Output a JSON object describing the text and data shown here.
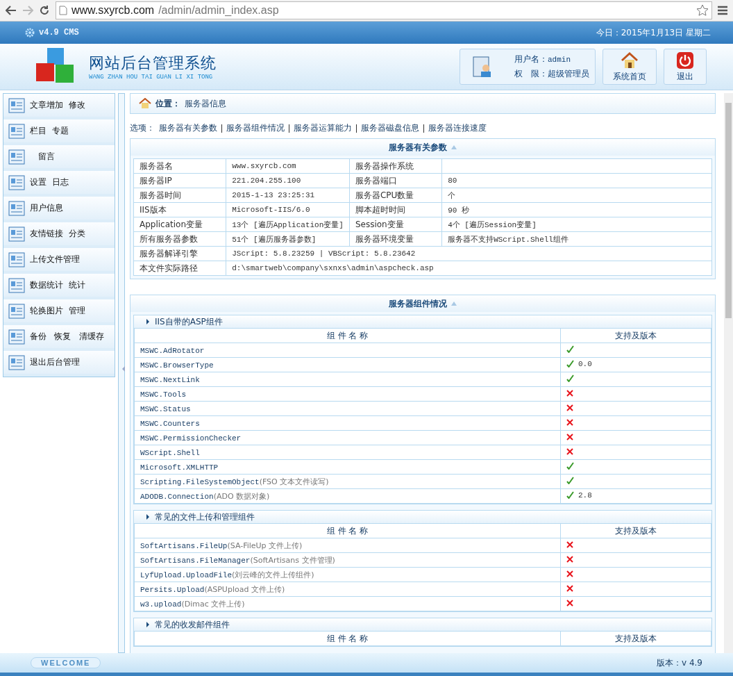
{
  "browser": {
    "url_host": "www.sxyrcb.com",
    "url_path": "/admin/admin_index.asp"
  },
  "topbar": {
    "version": "v4.9 CMS",
    "date": "今日：2015年1月13日 星期二"
  },
  "header": {
    "title": "网站后台管理系统",
    "subtitle": "WANG ZHAN HOU TAI GUAN LI XI TONG",
    "user_label": "用户名：",
    "user": "admin",
    "role_label": "权　限：",
    "role": "超级管理员",
    "buttons": [
      {
        "label": "系统首页",
        "kind": "home"
      },
      {
        "label": "退出",
        "kind": "exit"
      }
    ]
  },
  "sidebar": {
    "items": [
      {
        "label": "文章增加  修改"
      },
      {
        "label": "栏目  专题"
      },
      {
        "label": "　留言"
      },
      {
        "label": "设置  日志"
      },
      {
        "label": "用户信息"
      },
      {
        "label": "友情链接  分类"
      },
      {
        "label": "上传文件管理"
      },
      {
        "label": "数据统计  统计"
      },
      {
        "label": "轮换图片  管理"
      },
      {
        "label": "备份   恢复   清缓存"
      },
      {
        "label": "退出后台管理"
      }
    ]
  },
  "breadcrumb": {
    "label": "位置：",
    "value": "服务器信息"
  },
  "options": {
    "label": "选项：",
    "links": [
      "服务器有关参数",
      "服务器组件情况",
      "服务器运算能力",
      "服务器磁盘信息",
      "服务器连接速度"
    ]
  },
  "params": {
    "title": "服务器有关参数",
    "rows": [
      [
        "服务器名",
        "www.sxyrcb.com",
        "服务器操作系统"
      ],
      [
        "服务器IP",
        "221.204.255.100",
        "服务器端口",
        "80"
      ],
      [
        "服务器时间",
        "2015-1-13 23:25:31",
        "服务器CPU数量",
        " 个"
      ],
      [
        "IIS版本",
        "Microsoft-IIS/6.0",
        "脚本超时时间",
        "90 秒"
      ],
      [
        "Application变量",
        "13个 [遍历Application变量]",
        "Session变量",
        "4个 [遍历Session变量]"
      ],
      [
        "所有服务器参数",
        "51个 [遍历服务器参数]",
        "服务器环境变量",
        "服务器不支持WScript.Shell组件"
      ],
      [
        "服务器解译引擎",
        {
          "text": "JScript: 5.8.23259 | VBScript: 5.8.23642",
          "colspan": 3
        }
      ],
      [
        "本文件实际路径",
        {
          "text": "d:\\smartweb\\company\\sxnxs\\admin\\aspcheck.asp",
          "colspan": 3
        }
      ]
    ]
  },
  "components": {
    "title": "服务器组件情况",
    "groups": [
      {
        "title": "IIS自带的ASP组件",
        "columns": [
          "组 件 名 称",
          "支持及版本"
        ],
        "rows": [
          {
            "name": "MSWC.AdRotator",
            "supported": true
          },
          {
            "name": "MSWC.BrowserType",
            "supported": true,
            "version": "0.0"
          },
          {
            "name": "MSWC.NextLink",
            "supported": true
          },
          {
            "name": "MSWC.Tools",
            "supported": false
          },
          {
            "name": "MSWC.Status",
            "supported": false
          },
          {
            "name": "MSWC.Counters",
            "supported": false
          },
          {
            "name": "MSWC.PermissionChecker",
            "supported": false
          },
          {
            "name": "WScript.Shell",
            "supported": false
          },
          {
            "name": "Microsoft.XMLHTTP",
            "supported": true
          },
          {
            "name": "Scripting.FileSystemObject",
            "note": "(FSO 文本文件读写)",
            "supported": true
          },
          {
            "name": "ADODB.Connection",
            "note": "(ADO 数据对象)",
            "supported": true,
            "version": "2.8"
          }
        ]
      },
      {
        "title": "常见的文件上传和管理组件",
        "columns": [
          "组 件 名 称",
          "支持及版本"
        ],
        "rows": [
          {
            "name": "SoftArtisans.FileUp",
            "note": "(SA-FileUp 文件上传)",
            "supported": false
          },
          {
            "name": "SoftArtisans.FileManager",
            "note": "(SoftArtisans 文件管理)",
            "supported": false
          },
          {
            "name": "LyfUpload.UploadFile",
            "note": "(刘云峰的文件上传组件)",
            "supported": false
          },
          {
            "name": "Persits.Upload",
            "note": "(ASPUpload 文件上传)",
            "supported": false
          },
          {
            "name": "w3.upload",
            "note": "(Dimac 文件上传)",
            "supported": false
          }
        ]
      },
      {
        "title": "常见的收发邮件组件",
        "columns": [
          "组 件 名 称",
          "支持及版本"
        ]
      }
    ]
  },
  "footer": {
    "welcome": "WELCOME",
    "version": "版本：v 4.9"
  }
}
